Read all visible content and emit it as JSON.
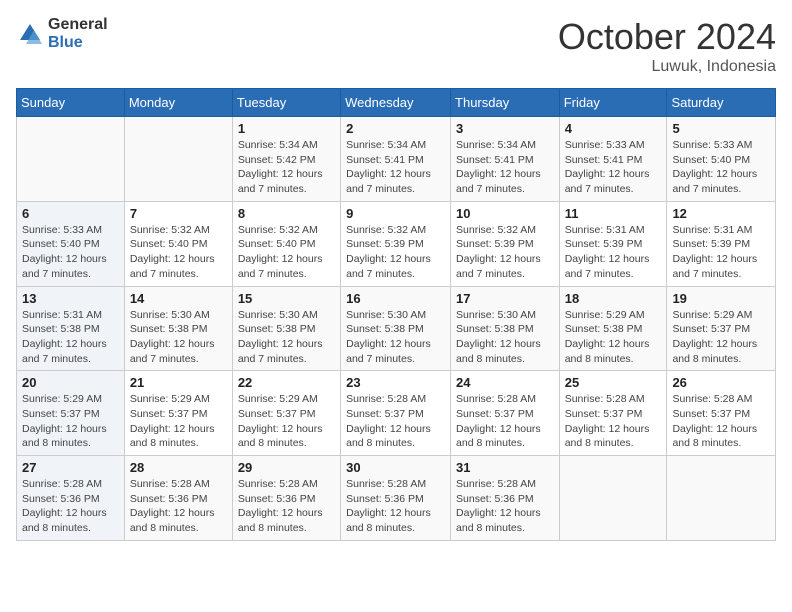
{
  "logo": {
    "general": "General",
    "blue": "Blue"
  },
  "title": "October 2024",
  "location": "Luwuk, Indonesia",
  "days_header": [
    "Sunday",
    "Monday",
    "Tuesday",
    "Wednesday",
    "Thursday",
    "Friday",
    "Saturday"
  ],
  "weeks": [
    [
      {
        "day": "",
        "info": ""
      },
      {
        "day": "",
        "info": ""
      },
      {
        "day": "1",
        "info": "Sunrise: 5:34 AM\nSunset: 5:42 PM\nDaylight: 12 hours and 7 minutes."
      },
      {
        "day": "2",
        "info": "Sunrise: 5:34 AM\nSunset: 5:41 PM\nDaylight: 12 hours and 7 minutes."
      },
      {
        "day": "3",
        "info": "Sunrise: 5:34 AM\nSunset: 5:41 PM\nDaylight: 12 hours and 7 minutes."
      },
      {
        "day": "4",
        "info": "Sunrise: 5:33 AM\nSunset: 5:41 PM\nDaylight: 12 hours and 7 minutes."
      },
      {
        "day": "5",
        "info": "Sunrise: 5:33 AM\nSunset: 5:40 PM\nDaylight: 12 hours and 7 minutes."
      }
    ],
    [
      {
        "day": "6",
        "info": "Sunrise: 5:33 AM\nSunset: 5:40 PM\nDaylight: 12 hours and 7 minutes."
      },
      {
        "day": "7",
        "info": "Sunrise: 5:32 AM\nSunset: 5:40 PM\nDaylight: 12 hours and 7 minutes."
      },
      {
        "day": "8",
        "info": "Sunrise: 5:32 AM\nSunset: 5:40 PM\nDaylight: 12 hours and 7 minutes."
      },
      {
        "day": "9",
        "info": "Sunrise: 5:32 AM\nSunset: 5:39 PM\nDaylight: 12 hours and 7 minutes."
      },
      {
        "day": "10",
        "info": "Sunrise: 5:32 AM\nSunset: 5:39 PM\nDaylight: 12 hours and 7 minutes."
      },
      {
        "day": "11",
        "info": "Sunrise: 5:31 AM\nSunset: 5:39 PM\nDaylight: 12 hours and 7 minutes."
      },
      {
        "day": "12",
        "info": "Sunrise: 5:31 AM\nSunset: 5:39 PM\nDaylight: 12 hours and 7 minutes."
      }
    ],
    [
      {
        "day": "13",
        "info": "Sunrise: 5:31 AM\nSunset: 5:38 PM\nDaylight: 12 hours and 7 minutes."
      },
      {
        "day": "14",
        "info": "Sunrise: 5:30 AM\nSunset: 5:38 PM\nDaylight: 12 hours and 7 minutes."
      },
      {
        "day": "15",
        "info": "Sunrise: 5:30 AM\nSunset: 5:38 PM\nDaylight: 12 hours and 7 minutes."
      },
      {
        "day": "16",
        "info": "Sunrise: 5:30 AM\nSunset: 5:38 PM\nDaylight: 12 hours and 7 minutes."
      },
      {
        "day": "17",
        "info": "Sunrise: 5:30 AM\nSunset: 5:38 PM\nDaylight: 12 hours and 8 minutes."
      },
      {
        "day": "18",
        "info": "Sunrise: 5:29 AM\nSunset: 5:38 PM\nDaylight: 12 hours and 8 minutes."
      },
      {
        "day": "19",
        "info": "Sunrise: 5:29 AM\nSunset: 5:37 PM\nDaylight: 12 hours and 8 minutes."
      }
    ],
    [
      {
        "day": "20",
        "info": "Sunrise: 5:29 AM\nSunset: 5:37 PM\nDaylight: 12 hours and 8 minutes."
      },
      {
        "day": "21",
        "info": "Sunrise: 5:29 AM\nSunset: 5:37 PM\nDaylight: 12 hours and 8 minutes."
      },
      {
        "day": "22",
        "info": "Sunrise: 5:29 AM\nSunset: 5:37 PM\nDaylight: 12 hours and 8 minutes."
      },
      {
        "day": "23",
        "info": "Sunrise: 5:28 AM\nSunset: 5:37 PM\nDaylight: 12 hours and 8 minutes."
      },
      {
        "day": "24",
        "info": "Sunrise: 5:28 AM\nSunset: 5:37 PM\nDaylight: 12 hours and 8 minutes."
      },
      {
        "day": "25",
        "info": "Sunrise: 5:28 AM\nSunset: 5:37 PM\nDaylight: 12 hours and 8 minutes."
      },
      {
        "day": "26",
        "info": "Sunrise: 5:28 AM\nSunset: 5:37 PM\nDaylight: 12 hours and 8 minutes."
      }
    ],
    [
      {
        "day": "27",
        "info": "Sunrise: 5:28 AM\nSunset: 5:36 PM\nDaylight: 12 hours and 8 minutes."
      },
      {
        "day": "28",
        "info": "Sunrise: 5:28 AM\nSunset: 5:36 PM\nDaylight: 12 hours and 8 minutes."
      },
      {
        "day": "29",
        "info": "Sunrise: 5:28 AM\nSunset: 5:36 PM\nDaylight: 12 hours and 8 minutes."
      },
      {
        "day": "30",
        "info": "Sunrise: 5:28 AM\nSunset: 5:36 PM\nDaylight: 12 hours and 8 minutes."
      },
      {
        "day": "31",
        "info": "Sunrise: 5:28 AM\nSunset: 5:36 PM\nDaylight: 12 hours and 8 minutes."
      },
      {
        "day": "",
        "info": ""
      },
      {
        "day": "",
        "info": ""
      }
    ]
  ]
}
